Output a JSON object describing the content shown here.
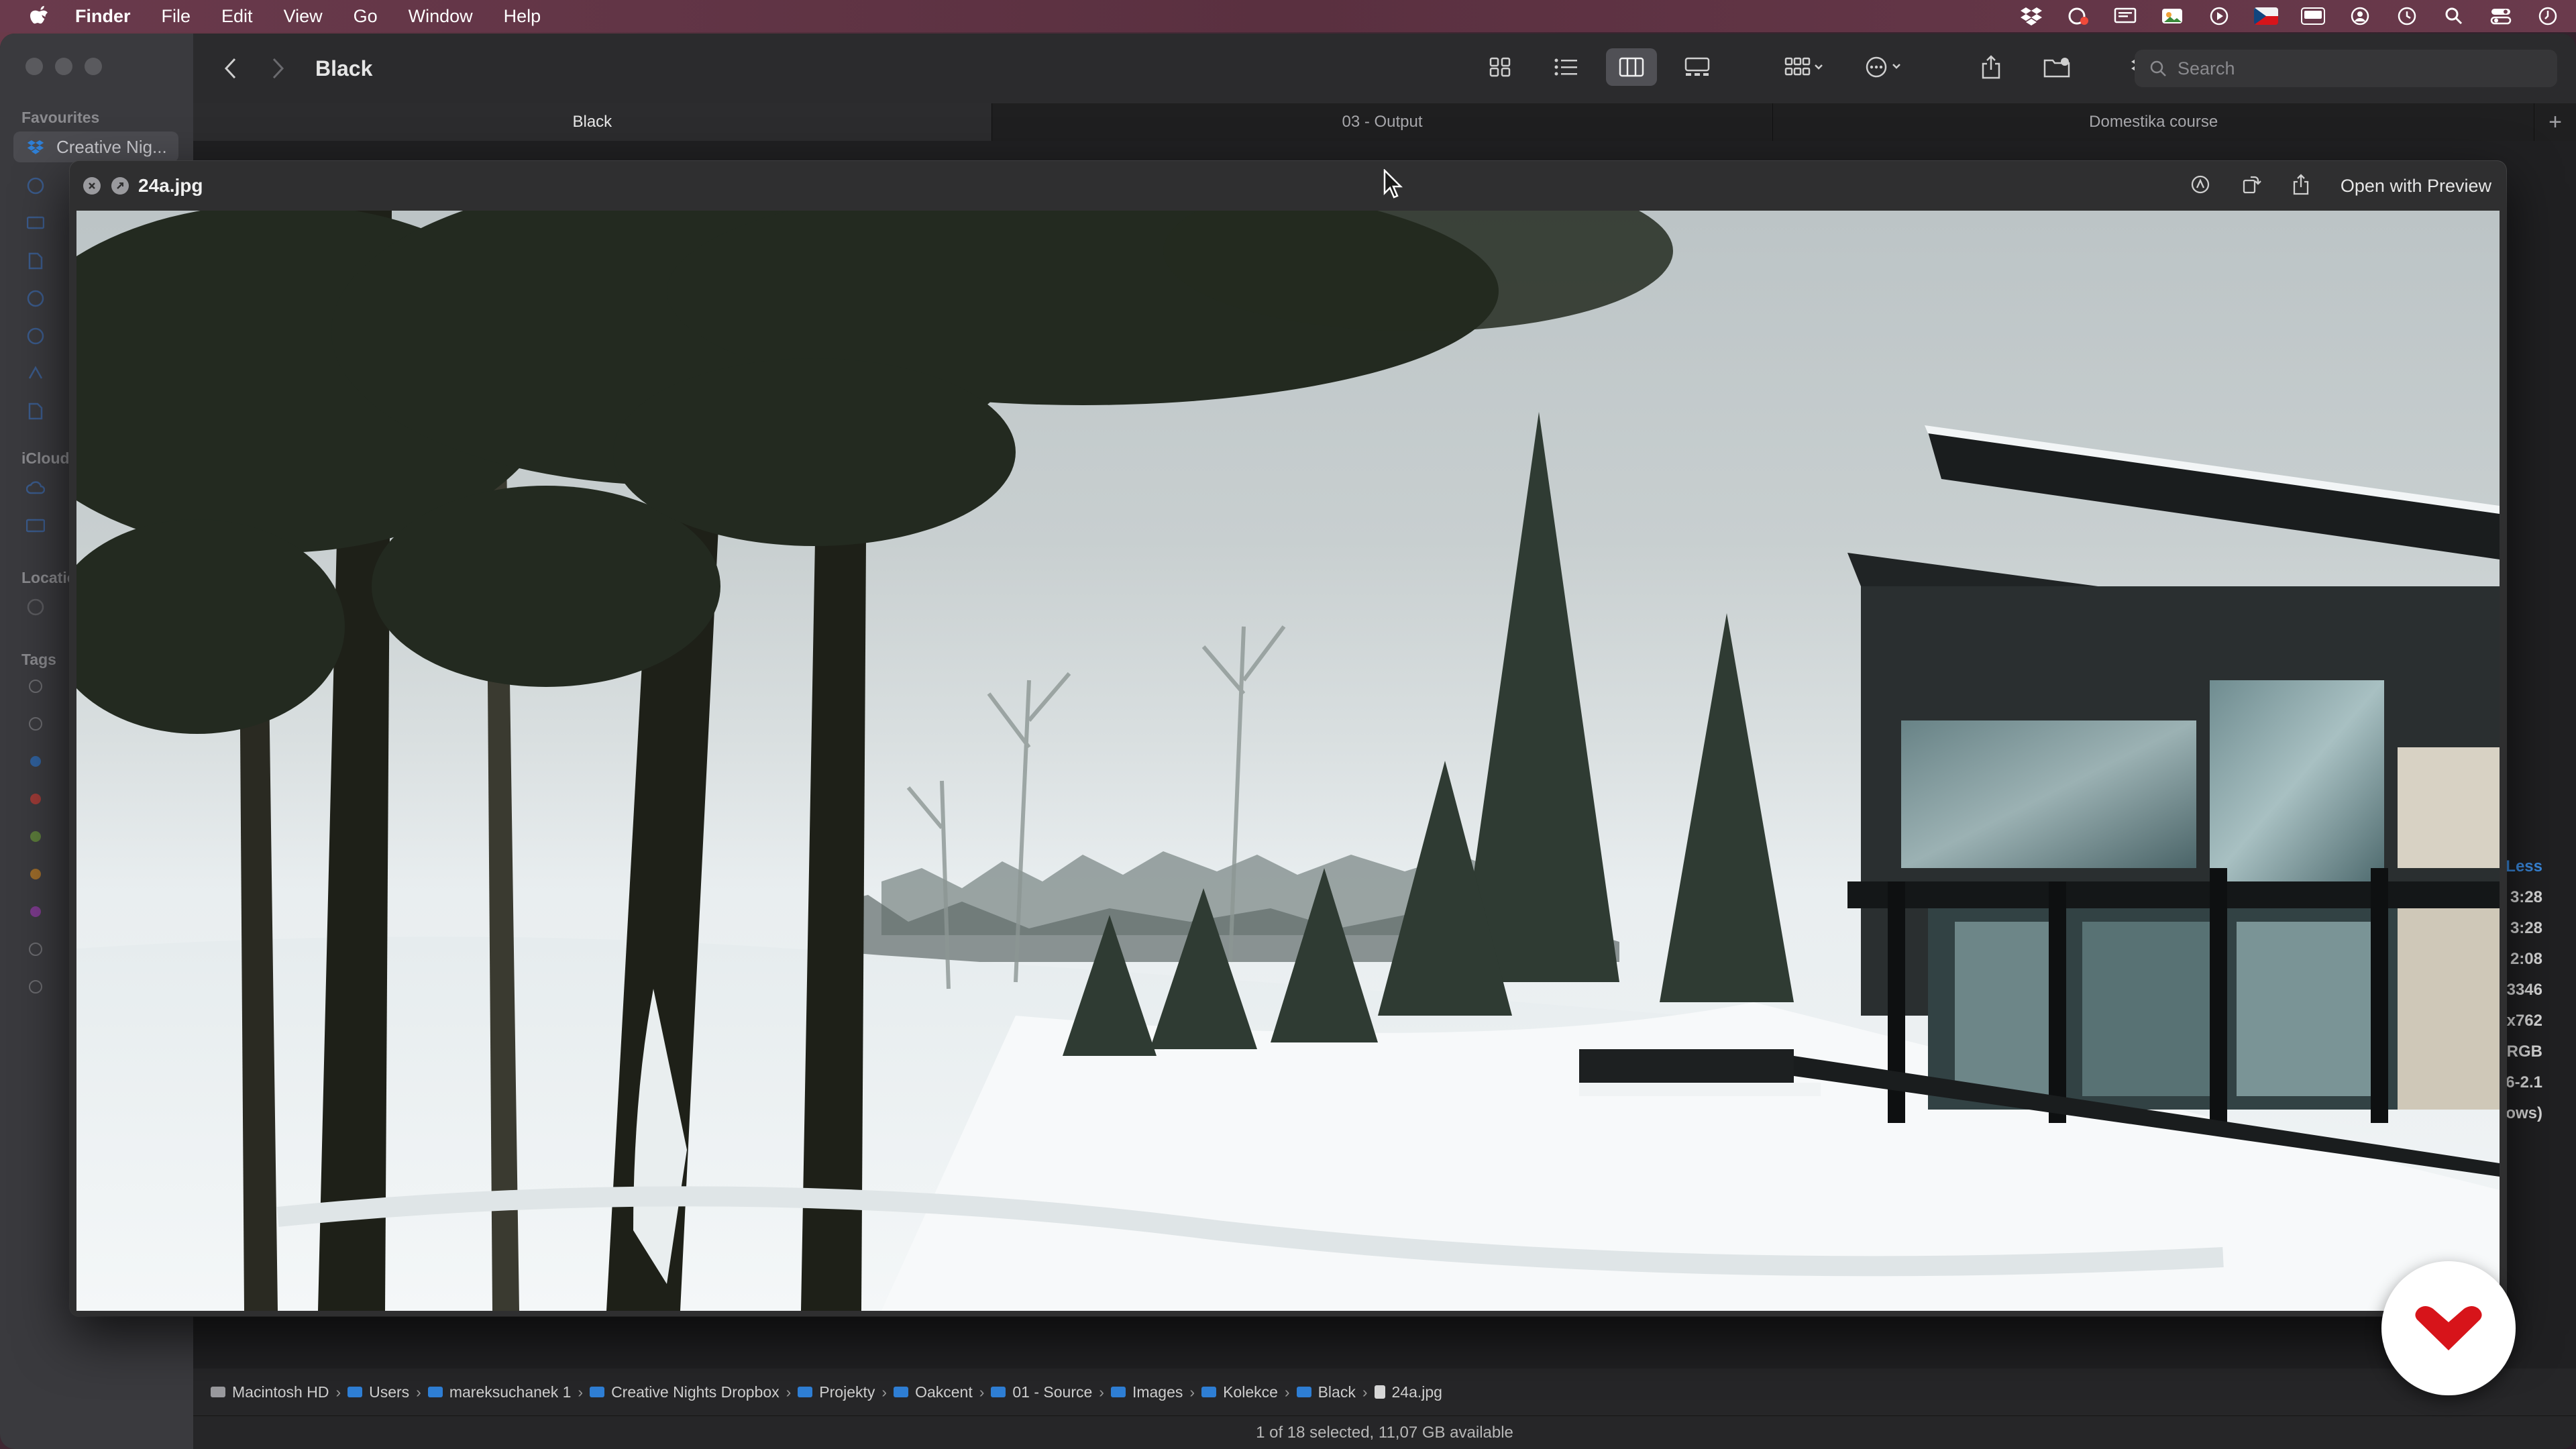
{
  "menubar": {
    "app": "Finder",
    "items": [
      "File",
      "Edit",
      "View",
      "Go",
      "Window",
      "Help"
    ]
  },
  "sidebar": {
    "favourites_label": "Favourites",
    "selected_item": "Creative Nig...",
    "icloud_label": "iCloud",
    "locations_label": "Locations",
    "tags_label": "Tags",
    "tag_colors": [
      "#7a7a7e",
      "#7a7a7e",
      "#2f7fd6",
      "#e0443a",
      "#8bbf3a",
      "#f0a23a",
      "#a94fd1",
      "#7a7a7e",
      "#7a7a7e"
    ]
  },
  "toolbar": {
    "title": "Black",
    "search_placeholder": "Search"
  },
  "tabs": [
    "Black",
    "03 - Output",
    "Domestika course"
  ],
  "quicklook": {
    "filename": "24a.jpg",
    "open_with": "Open with Preview"
  },
  "info_panel": {
    "more_less": "Less",
    "values": [
      "3:28",
      "3:28",
      "2:08",
      "3346",
      "x762",
      "RGB",
      "6-2.1",
      "ows)"
    ]
  },
  "pathbar": {
    "segments": [
      "Macintosh HD",
      "Users",
      "mareksuchanek 1",
      "Creative Nights Dropbox",
      "Projekty",
      "Oakcent",
      "01 - Source",
      "Images",
      "Kolekce",
      "Black",
      "24a.jpg"
    ]
  },
  "status": "1 of 18 selected, 11,07 GB available",
  "colors": {
    "accent": "#2f7fd6",
    "badge": "#d7141a"
  }
}
